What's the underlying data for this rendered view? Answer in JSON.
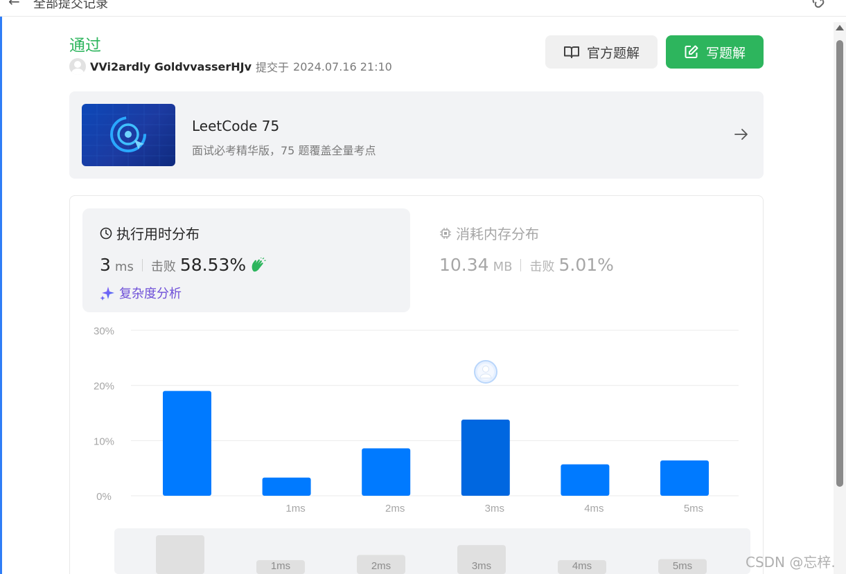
{
  "topbar": {
    "back_icon": "arrow-left-icon",
    "title": "全部提交记录",
    "link_icon": "link-icon"
  },
  "submission": {
    "status": "通过",
    "username": "VVi2ardly GoldvvasserHJv",
    "submitted_label": "提交于",
    "submitted_time": "2024.07.16 21:10"
  },
  "actions": {
    "official_label": "官方题解",
    "write_label": "写题解"
  },
  "promo": {
    "title": "LeetCode 75",
    "subtitle": "面试必考精华版，75 题覆盖全量考点"
  },
  "runtime": {
    "heading": "执行用时分布",
    "value": "3",
    "unit": "ms",
    "beats_label": "击败",
    "beats_percent": "58.53%",
    "complexity_label": "复杂度分析"
  },
  "memory": {
    "heading": "消耗内存分布",
    "value": "10.34",
    "unit": "MB",
    "beats_label": "击败",
    "beats_percent": "5.01%"
  },
  "colors": {
    "accent_green": "#2db55d",
    "bar_blue": "#007aff",
    "bar_highlight": "#0067e0"
  },
  "chart_data": {
    "type": "bar",
    "categories": [
      "",
      "1ms",
      "2ms",
      "3ms",
      "4ms",
      "5ms"
    ],
    "values": [
      19,
      3.3,
      8.6,
      13.8,
      5.7,
      6.4
    ],
    "highlight_index": 3,
    "y_ticks": [
      "0%",
      "10%",
      "20%",
      "30%"
    ],
    "ylim": [
      0,
      30
    ],
    "grid": true,
    "mini_categories": [
      "",
      "1ms",
      "2ms",
      "3ms",
      "4ms",
      "5ms"
    ]
  },
  "watermark": "CSDN @忘梓."
}
